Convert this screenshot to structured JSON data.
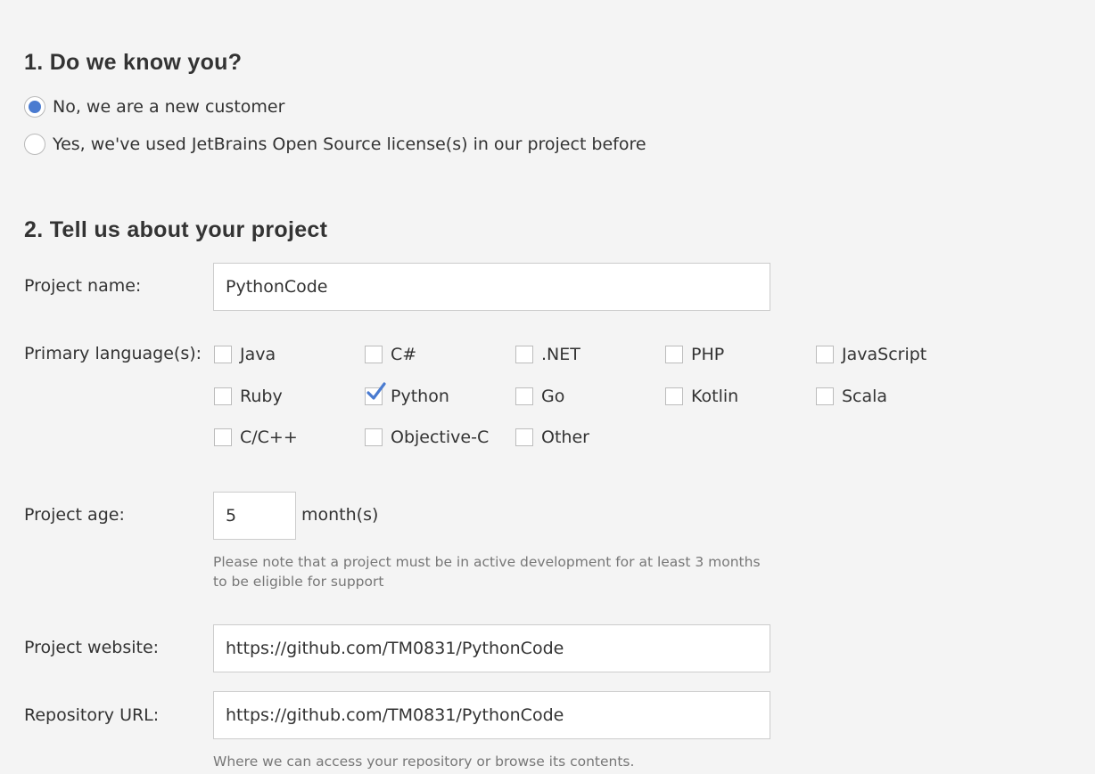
{
  "section1": {
    "title": "1.  Do we know you?",
    "options": [
      {
        "label": "No, we are a new customer",
        "checked": true
      },
      {
        "label": "Yes, we've used JetBrains Open Source license(s) in our project before",
        "checked": false
      }
    ]
  },
  "section2": {
    "title": "2. Tell us about your project",
    "project_name": {
      "label": "Project name:",
      "value": "PythonCode"
    },
    "languages": {
      "label": "Primary language(s):",
      "items": [
        {
          "label": "Java",
          "checked": false
        },
        {
          "label": "C#",
          "checked": false
        },
        {
          "label": ".NET",
          "checked": false
        },
        {
          "label": "PHP",
          "checked": false
        },
        {
          "label": "JavaScript",
          "checked": false
        },
        {
          "label": "Ruby",
          "checked": false
        },
        {
          "label": "Python",
          "checked": true
        },
        {
          "label": "Go",
          "checked": false
        },
        {
          "label": "Kotlin",
          "checked": false
        },
        {
          "label": "Scala",
          "checked": false
        },
        {
          "label": "C/C++",
          "checked": false
        },
        {
          "label": "Objective-C",
          "checked": false
        },
        {
          "label": "Other",
          "checked": false
        }
      ]
    },
    "project_age": {
      "label": "Project age:",
      "value": "5",
      "unit": "month(s)",
      "help": "Please note that a project must be in active development for at least 3 months to be eligible for support"
    },
    "project_website": {
      "label": "Project website:",
      "value": "https://github.com/TM0831/PythonCode"
    },
    "repository_url": {
      "label": "Repository URL:",
      "value": "https://github.com/TM0831/PythonCode",
      "help": "Where we can access your repository or browse its contents."
    }
  },
  "colors": {
    "background": "#f4f4f4",
    "accent": "#4a7bd0",
    "text": "#333333",
    "muted": "#777777"
  }
}
